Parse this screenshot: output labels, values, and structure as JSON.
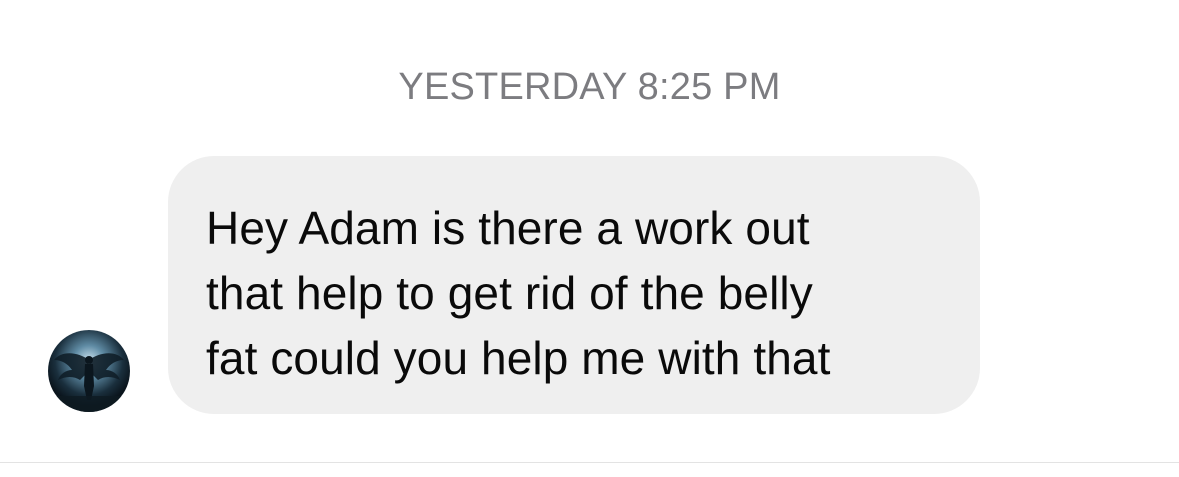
{
  "thread": {
    "timestamp": "YESTERDAY 8:25 PM",
    "messages": [
      {
        "sender": "contact",
        "avatar_icon": "angel-wings-avatar-icon",
        "text": "Hey Adam is there a work out\nthat help to get rid of the belly\nfat could you help me with that"
      }
    ]
  },
  "colors": {
    "background": "#ffffff",
    "bubble": "#efefef",
    "timestamp": "#7c7c80",
    "text": "#0a0a0a",
    "divider": "#e3e3e3"
  }
}
